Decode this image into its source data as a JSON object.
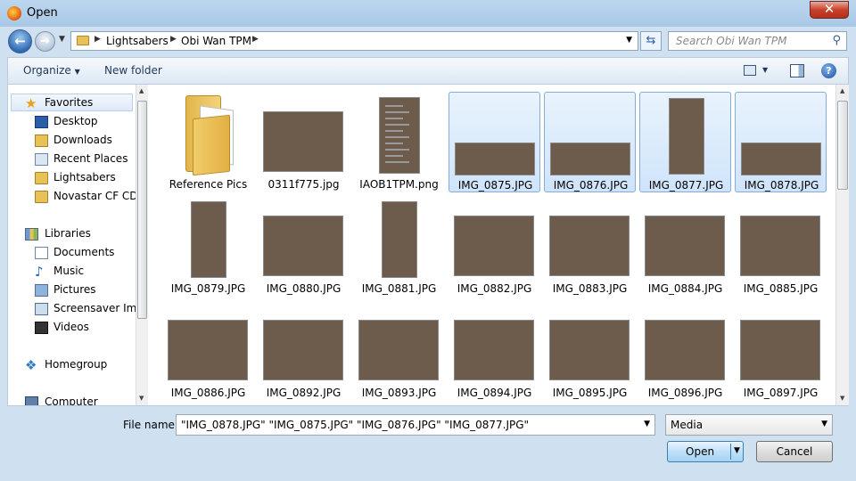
{
  "window": {
    "title": "Open",
    "close_label": "✕"
  },
  "address": {
    "crumbs": [
      "Lightsabers",
      "Obi Wan TPM"
    ],
    "search_placeholder": "Search Obi Wan TPM"
  },
  "toolbar": {
    "organize_label": "Organize",
    "new_folder_label": "New folder"
  },
  "sidebar": {
    "favorites_label": "Favorites",
    "favorites": [
      "Desktop",
      "Downloads",
      "Recent Places",
      "Lightsabers",
      "Novastar CF CDs"
    ],
    "libraries_label": "Libraries",
    "libraries": [
      "Documents",
      "Music",
      "Pictures",
      "Screensaver Imag",
      "Videos"
    ],
    "homegroup_label": "Homegroup",
    "computer_label": "Computer"
  },
  "files": [
    {
      "name": "Reference Pics",
      "kind": "folder",
      "selected": false
    },
    {
      "name": "0311f775.jpg",
      "kind": "photo",
      "selected": false
    },
    {
      "name": "IAOB1TPM.png",
      "kind": "doc",
      "selected": false
    },
    {
      "name": "IMG_0875.JPG",
      "kind": "photo",
      "selected": true
    },
    {
      "name": "IMG_0876.JPG",
      "kind": "photo",
      "selected": true
    },
    {
      "name": "IMG_0877.JPG",
      "kind": "photo",
      "selected": true
    },
    {
      "name": "IMG_0878.JPG",
      "kind": "photo",
      "selected": true
    },
    {
      "name": "IMG_0879.JPG",
      "kind": "photo",
      "selected": false
    },
    {
      "name": "IMG_0880.JPG",
      "kind": "photo",
      "selected": false
    },
    {
      "name": "IMG_0881.JPG",
      "kind": "photo",
      "selected": false
    },
    {
      "name": "IMG_0882.JPG",
      "kind": "photo",
      "selected": false
    },
    {
      "name": "IMG_0883.JPG",
      "kind": "photo",
      "selected": false
    },
    {
      "name": "IMG_0884.JPG",
      "kind": "photo",
      "selected": false
    },
    {
      "name": "IMG_0885.JPG",
      "kind": "photo",
      "selected": false
    },
    {
      "name": "IMG_0886.JPG",
      "kind": "photo",
      "selected": false
    },
    {
      "name": "IMG_0892.JPG",
      "kind": "photo",
      "selected": false
    },
    {
      "name": "IMG_0893.JPG",
      "kind": "photo",
      "selected": false
    },
    {
      "name": "IMG_0894.JPG",
      "kind": "photo",
      "selected": false
    },
    {
      "name": "IMG_0895.JPG",
      "kind": "photo",
      "selected": false
    },
    {
      "name": "IMG_0896.JPG",
      "kind": "photo",
      "selected": false
    },
    {
      "name": "IMG_0897.JPG",
      "kind": "photo",
      "selected": false
    }
  ],
  "footer": {
    "file_name_label": "File name:",
    "file_name_value": "\"IMG_0878.JPG\" \"IMG_0875.JPG\" \"IMG_0876.JPG\" \"IMG_0877.JPG\"",
    "file_type_value": "Media",
    "open_label": "Open",
    "cancel_label": "Cancel"
  }
}
